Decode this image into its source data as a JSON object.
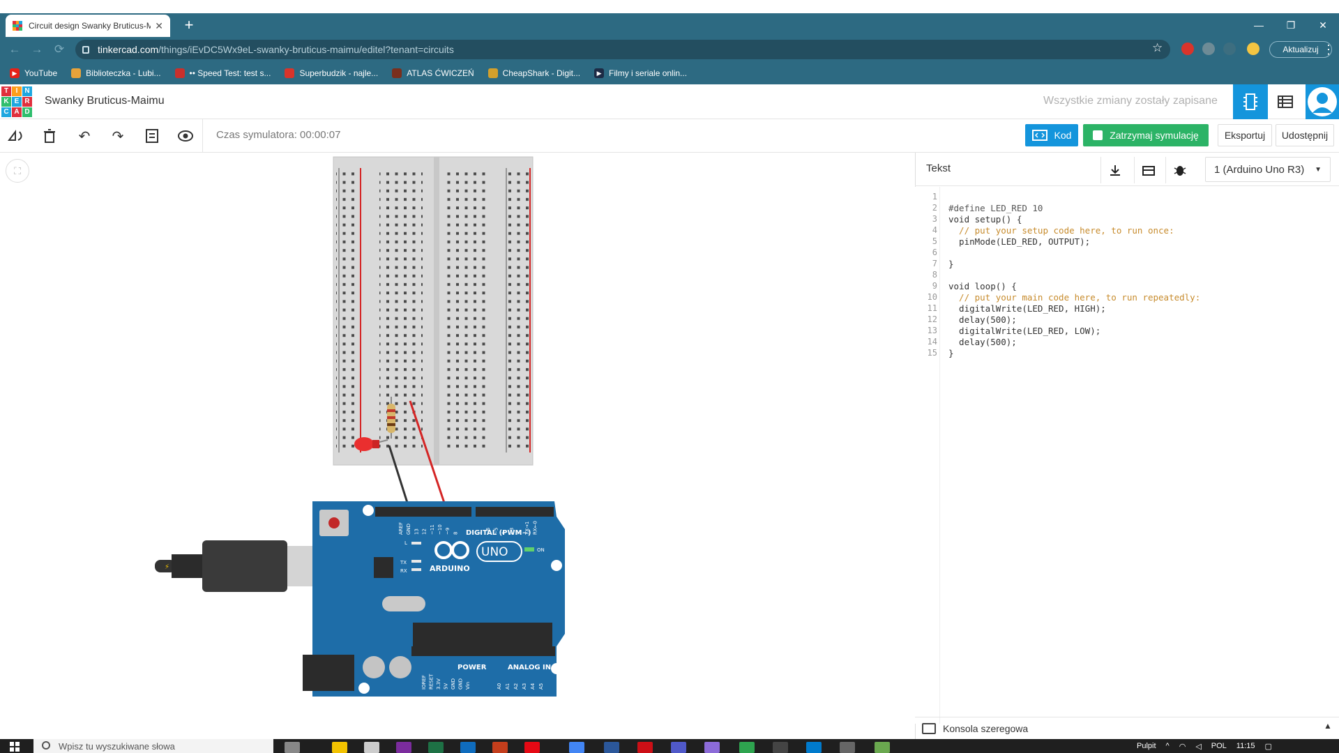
{
  "browser": {
    "tab_title": "Circuit design Swanky Bruticus-M",
    "url_host": "tinkercad.com",
    "url_path": "/things/iEvDC5Wx9eL-swanky-bruticus-maimu/editel?tenant=circuits",
    "update_label": "Aktualizuj",
    "bookmarks": [
      {
        "label": "YouTube",
        "color": "#e62117"
      },
      {
        "label": "Biblioteczka - Lubi...",
        "color": "#e8a33a"
      },
      {
        "label": "•• Speed Test: test s...",
        "color": "#c9302c"
      },
      {
        "label": "Superbudzik - najle...",
        "color": "#d9342b"
      },
      {
        "label": "ATLAS ĆWICZEŃ",
        "color": "#7a2f1d"
      },
      {
        "label": "CheapShark - Digit...",
        "color": "#d3a02c"
      },
      {
        "label": "Filmy i seriale onlin...",
        "color": "#1d2b45"
      }
    ]
  },
  "app": {
    "logo_letters": [
      "T",
      "I",
      "N",
      "K",
      "E",
      "R",
      "C",
      "A",
      "D"
    ],
    "design_name": "Swanky Bruticus-Maimu",
    "save_status": "Wszystkie zmiany zostały zapisane"
  },
  "toolbar": {
    "sim_time": "Czas symulatora: 00:00:07",
    "code_label": "Kod",
    "stop_label": "Zatrzymaj symulację",
    "export_label": "Eksportuj",
    "share_label": "Udostępnij"
  },
  "code_panel": {
    "mode": "Tekst",
    "board": "1 (Arduino Uno R3)",
    "lines": [
      "",
      "#define LED_RED 10",
      "void setup() {",
      "  // put your setup code here, to run once:",
      "  pinMode(LED_RED, OUTPUT);",
      "",
      "}",
      "",
      "void loop() {",
      "  // put your main code here, to run repeatedly:",
      "  digitalWrite(LED_RED, HIGH);",
      "  delay(500);",
      "  digitalWrite(LED_RED, LOW);",
      "  delay(500);",
      "}"
    ],
    "serial_label": "Konsola szeregowa"
  },
  "board": {
    "brand": "ARDUINO",
    "model": "UNO",
    "digital_label": "DIGITAL (PWM~)",
    "power_label": "POWER",
    "analog_label": "ANALOG IN",
    "on_label": "ON",
    "aref_pins": [
      "AREF",
      "GND",
      "13",
      "12",
      "~11",
      "~10",
      "~9",
      "8"
    ],
    "digital_pins": [
      "7",
      "~6",
      "~5",
      "4",
      "~3",
      "2",
      "TX→1",
      "RX←0"
    ],
    "power_pins": [
      "IOREF",
      "RESET",
      "3.3V",
      "5V",
      "GND",
      "GND",
      "Vin"
    ],
    "analog_pins": [
      "A0",
      "A1",
      "A2",
      "A3",
      "A4",
      "A5"
    ],
    "l_label": "L",
    "tx_label": "TX",
    "rx_label": "RX"
  },
  "taskbar": {
    "search_placeholder": "Wpisz tu wyszukiwane słowa",
    "desktop_label": "Pulpit",
    "lang": "POL",
    "time": "11:15"
  }
}
